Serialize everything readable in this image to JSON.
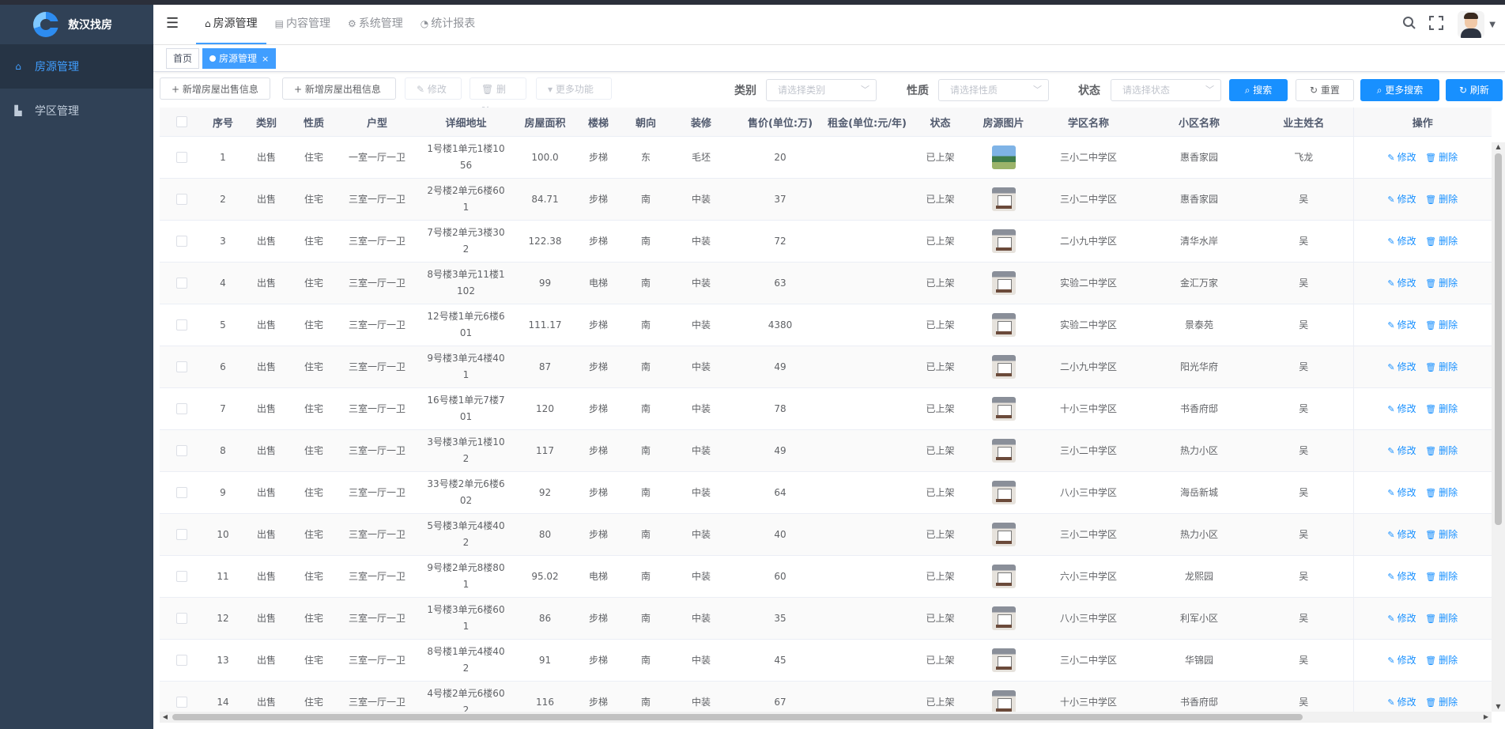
{
  "app": {
    "title": "敖汉找房"
  },
  "sidebar": {
    "items": [
      {
        "label": "房源管理",
        "icon": "home-icon"
      },
      {
        "label": "学区管理",
        "icon": "building-icon"
      }
    ]
  },
  "topmenu": {
    "items": [
      {
        "label": "房源管理",
        "icon": "home-icon"
      },
      {
        "label": "内容管理",
        "icon": "list-icon"
      },
      {
        "label": "系统管理",
        "icon": "gear-icon"
      },
      {
        "label": "统计报表",
        "icon": "dashboard-icon"
      }
    ]
  },
  "tags": {
    "home": "首页",
    "current": "房源管理",
    "close": "×"
  },
  "toolbar": {
    "add_sale": "+ 新增房屋出售信息",
    "add_rent": "+ 新增房屋出租信息",
    "edit": "✎ 修改",
    "delete": "🗑 删除",
    "more_functions": "▾ 更多功能"
  },
  "filters": {
    "category": {
      "label": "类别",
      "placeholder": "请选择类别"
    },
    "nature": {
      "label": "性质",
      "placeholder": "请选择性质"
    },
    "status": {
      "label": "状态",
      "placeholder": "请选择状态"
    }
  },
  "buttons": {
    "search": "搜索",
    "reset": "重置",
    "more_search": "更多搜索",
    "refresh": "刷新"
  },
  "table": {
    "headers": [
      "序号",
      "类别",
      "性质",
      "户型",
      "详细地址",
      "房屋面积",
      "楼梯",
      "朝向",
      "装修",
      "售价(单位:万)",
      "租金(单位:元/年)",
      "状态",
      "房源图片",
      "学区名称",
      "小区名称",
      "业主姓名",
      "操作"
    ],
    "edit_label": "修改",
    "delete_label": "删除",
    "rows": [
      {
        "no": "1",
        "category": "出售",
        "nature": "住宅",
        "layout": "一室一厅一卫",
        "address": "1号楼1单元1楼1056",
        "area": "100.0",
        "stairs": "步梯",
        "orientation": "东",
        "decoration": "毛坯",
        "price": "20",
        "rent": "",
        "status": "已上架",
        "image": "landscape",
        "school": "三小二中学区",
        "community": "惠香家园",
        "owner": "飞龙"
      },
      {
        "no": "2",
        "category": "出售",
        "nature": "住宅",
        "layout": "三室一厅一卫",
        "address": "2号楼2单元6楼601",
        "area": "84.71",
        "stairs": "步梯",
        "orientation": "南",
        "decoration": "中装",
        "price": "37",
        "rent": "",
        "status": "已上架",
        "image": "room",
        "school": "三小二中学区",
        "community": "惠香家园",
        "owner": "吴"
      },
      {
        "no": "3",
        "category": "出售",
        "nature": "住宅",
        "layout": "三室一厅一卫",
        "address": "7号楼2单元3楼302",
        "area": "122.38",
        "stairs": "步梯",
        "orientation": "南",
        "decoration": "中装",
        "price": "72",
        "rent": "",
        "status": "已上架",
        "image": "room",
        "school": "二小九中学区",
        "community": "清华水岸",
        "owner": "吴"
      },
      {
        "no": "4",
        "category": "出售",
        "nature": "住宅",
        "layout": "三室一厅一卫",
        "address": "8号楼3单元11楼1102",
        "area": "99",
        "stairs": "电梯",
        "orientation": "南",
        "decoration": "中装",
        "price": "63",
        "rent": "",
        "status": "已上架",
        "image": "room",
        "school": "实验二中学区",
        "community": "金汇万家",
        "owner": "吴"
      },
      {
        "no": "5",
        "category": "出售",
        "nature": "住宅",
        "layout": "三室一厅一卫",
        "address": "12号楼1单元6楼601",
        "area": "111.17",
        "stairs": "步梯",
        "orientation": "南",
        "decoration": "中装",
        "price": "4380",
        "rent": "",
        "status": "已上架",
        "image": "room",
        "school": "实验二中学区",
        "community": "景泰苑",
        "owner": "吴"
      },
      {
        "no": "6",
        "category": "出售",
        "nature": "住宅",
        "layout": "三室一厅一卫",
        "address": "9号楼3单元4楼401",
        "area": "87",
        "stairs": "步梯",
        "orientation": "南",
        "decoration": "中装",
        "price": "49",
        "rent": "",
        "status": "已上架",
        "image": "room",
        "school": "二小九中学区",
        "community": "阳光华府",
        "owner": "吴"
      },
      {
        "no": "7",
        "category": "出售",
        "nature": "住宅",
        "layout": "三室一厅一卫",
        "address": "16号楼1单元7楼701",
        "area": "120",
        "stairs": "步梯",
        "orientation": "南",
        "decoration": "中装",
        "price": "78",
        "rent": "",
        "status": "已上架",
        "image": "room",
        "school": "十小三中学区",
        "community": "书香府邸",
        "owner": "吴"
      },
      {
        "no": "8",
        "category": "出售",
        "nature": "住宅",
        "layout": "三室一厅一卫",
        "address": "3号楼3单元1楼102",
        "area": "117",
        "stairs": "步梯",
        "orientation": "南",
        "decoration": "中装",
        "price": "49",
        "rent": "",
        "status": "已上架",
        "image": "room",
        "school": "三小二中学区",
        "community": "热力小区",
        "owner": "吴"
      },
      {
        "no": "9",
        "category": "出售",
        "nature": "住宅",
        "layout": "三室一厅一卫",
        "address": "33号楼2单元6楼602",
        "area": "92",
        "stairs": "步梯",
        "orientation": "南",
        "decoration": "中装",
        "price": "64",
        "rent": "",
        "status": "已上架",
        "image": "room",
        "school": "八小三中学区",
        "community": "海岳新城",
        "owner": "吴"
      },
      {
        "no": "10",
        "category": "出售",
        "nature": "住宅",
        "layout": "三室一厅一卫",
        "address": "5号楼3单元4楼402",
        "area": "80",
        "stairs": "步梯",
        "orientation": "南",
        "decoration": "中装",
        "price": "40",
        "rent": "",
        "status": "已上架",
        "image": "room",
        "school": "三小二中学区",
        "community": "热力小区",
        "owner": "吴"
      },
      {
        "no": "11",
        "category": "出售",
        "nature": "住宅",
        "layout": "三室一厅一卫",
        "address": "9号楼2单元8楼801",
        "area": "95.02",
        "stairs": "电梯",
        "orientation": "南",
        "decoration": "中装",
        "price": "60",
        "rent": "",
        "status": "已上架",
        "image": "room",
        "school": "六小三中学区",
        "community": "龙熙园",
        "owner": "吴"
      },
      {
        "no": "12",
        "category": "出售",
        "nature": "住宅",
        "layout": "三室一厅一卫",
        "address": "1号楼3单元6楼601",
        "area": "86",
        "stairs": "步梯",
        "orientation": "南",
        "decoration": "中装",
        "price": "35",
        "rent": "",
        "status": "已上架",
        "image": "room",
        "school": "八小三中学区",
        "community": "利军小区",
        "owner": "吴"
      },
      {
        "no": "13",
        "category": "出售",
        "nature": "住宅",
        "layout": "三室一厅一卫",
        "address": "8号楼1单元4楼402",
        "area": "91",
        "stairs": "步梯",
        "orientation": "南",
        "decoration": "中装",
        "price": "45",
        "rent": "",
        "status": "已上架",
        "image": "room",
        "school": "三小二中学区",
        "community": "华锦园",
        "owner": "吴"
      },
      {
        "no": "14",
        "category": "出售",
        "nature": "住宅",
        "layout": "三室一厅一卫",
        "address": "4号楼2单元6楼602",
        "area": "116",
        "stairs": "步梯",
        "orientation": "南",
        "decoration": "中装",
        "price": "67",
        "rent": "",
        "status": "已上架",
        "image": "room",
        "school": "十小三中学区",
        "community": "书香府邸",
        "owner": "吴"
      }
    ]
  },
  "colors": {
    "sidebar_bg": "#304156",
    "primary": "#1890ff",
    "active_menu": "#409eff"
  }
}
